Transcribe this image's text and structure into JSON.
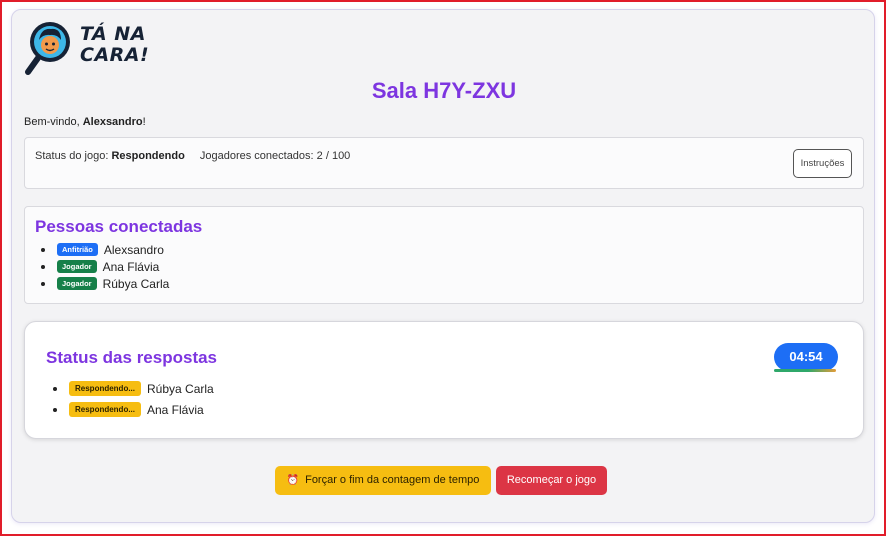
{
  "logo": {
    "text_line1": "TÁ NA",
    "text_line2": "CARA!"
  },
  "room": {
    "title": "Sala H7Y-ZXU"
  },
  "welcome": {
    "prefix": "Bem-vindo, ",
    "name": "Alexsandro",
    "suffix": "!"
  },
  "status": {
    "label": "Status do jogo: ",
    "value": "Respondendo",
    "players_text": "Jogadores conectados: 2 / 100",
    "instructions_button": "Instruções"
  },
  "people": {
    "title": "Pessoas conectadas",
    "items": [
      {
        "badge": "Anfitrião",
        "name": "Alexsandro",
        "role": "host"
      },
      {
        "badge": "Jogador",
        "name": "Ana Flávia",
        "role": "player"
      },
      {
        "badge": "Jogador",
        "name": "Rúbya Carla",
        "role": "player"
      }
    ]
  },
  "answers": {
    "title": "Status das respostas",
    "timer": "04:54",
    "items": [
      {
        "badge": "Respondendo...",
        "name": "Rúbya Carla"
      },
      {
        "badge": "Respondendo...",
        "name": "Ana Flávia"
      }
    ]
  },
  "actions": {
    "force_end_icon": "alarm-clock-icon",
    "force_end_label": "Forçar o fim da contagem de tempo",
    "restart_label": "Recomeçar o jogo"
  },
  "colors": {
    "accent": "#7d35e0",
    "host_badge": "#1d6ef5",
    "player_badge": "#168049",
    "responding_badge": "#f6bd11",
    "danger": "#dc3545"
  }
}
